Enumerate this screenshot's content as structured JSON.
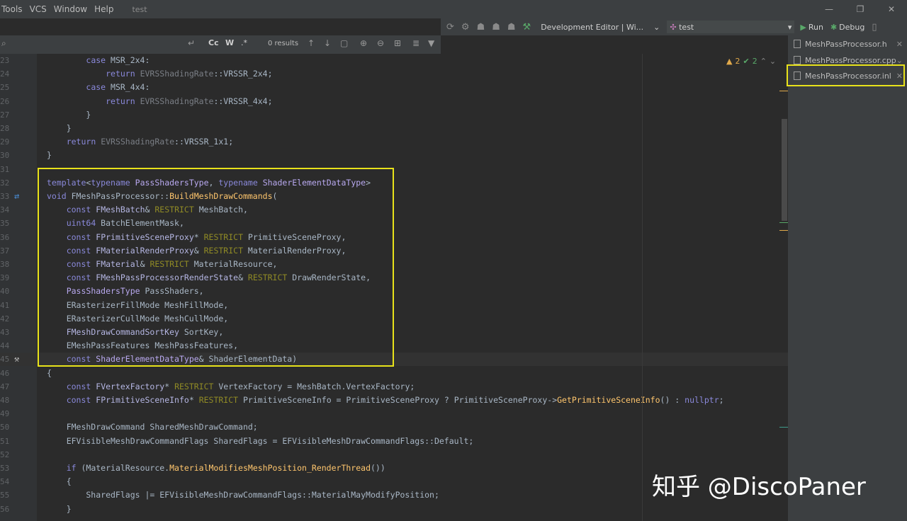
{
  "menu": [
    "Tools",
    "VCS",
    "Window",
    "Help"
  ],
  "window_title": "test",
  "run_toolbar": {
    "configuration": "Development Editor | Wi...",
    "target": "test",
    "run_label": "Run",
    "debug_label": "Debug"
  },
  "search": {
    "case_label": "Cc",
    "word_label": "W",
    "regex_label": ".*",
    "results": "0 results"
  },
  "editor_tabs": [
    "MeshPassProcessor.h",
    "MeshPassProcessor.cpp",
    "MeshPassProcessor.inl"
  ],
  "inspection": {
    "warnings": "2",
    "ok": "2"
  },
  "lines": [
    {
      "n": "23",
      "t": "        case MSR_2x4:"
    },
    {
      "n": "24",
      "t": "            return EVRSShadingRate::VRSSR_2x4;"
    },
    {
      "n": "25",
      "t": "        case MSR_4x4:"
    },
    {
      "n": "26",
      "t": "            return EVRSShadingRate::VRSSR_4x4;"
    },
    {
      "n": "27",
      "t": "        }"
    },
    {
      "n": "28",
      "t": "    }"
    },
    {
      "n": "29",
      "t": "    return EVRSShadingRate::VRSSR_1x1;"
    },
    {
      "n": "30",
      "t": "}"
    },
    {
      "n": "31",
      "t": ""
    },
    {
      "n": "32",
      "t": "template<typename PassShadersType, typename ShaderElementDataType>"
    },
    {
      "n": "33",
      "t": "void FMeshPassProcessor::BuildMeshDrawCommands("
    },
    {
      "n": "34",
      "t": "    const FMeshBatch& RESTRICT MeshBatch,"
    },
    {
      "n": "35",
      "t": "    uint64 BatchElementMask,"
    },
    {
      "n": "36",
      "t": "    const FPrimitiveSceneProxy* RESTRICT PrimitiveSceneProxy,"
    },
    {
      "n": "37",
      "t": "    const FMaterialRenderProxy& RESTRICT MaterialRenderProxy,"
    },
    {
      "n": "38",
      "t": "    const FMaterial& RESTRICT MaterialResource,"
    },
    {
      "n": "39",
      "t": "    const FMeshPassProcessorRenderState& RESTRICT DrawRenderState,"
    },
    {
      "n": "40",
      "t": "    PassShadersType PassShaders,"
    },
    {
      "n": "41",
      "t": "    ERasterizerFillMode MeshFillMode,"
    },
    {
      "n": "42",
      "t": "    ERasterizerCullMode MeshCullMode,"
    },
    {
      "n": "43",
      "t": "    FMeshDrawCommandSortKey SortKey,"
    },
    {
      "n": "44",
      "t": "    EMeshPassFeatures MeshPassFeatures,"
    },
    {
      "n": "45",
      "t": "    const ShaderElementDataType& ShaderElementData)"
    },
    {
      "n": "46",
      "t": "{"
    },
    {
      "n": "47",
      "t": "    const FVertexFactory* RESTRICT VertexFactory = MeshBatch.VertexFactory;"
    },
    {
      "n": "48",
      "t": "    const FPrimitiveSceneInfo* RESTRICT PrimitiveSceneInfo = PrimitiveSceneProxy ? PrimitiveSceneProxy->GetPrimitiveSceneInfo() : nullptr;"
    },
    {
      "n": "49",
      "t": ""
    },
    {
      "n": "50",
      "t": "    FMeshDrawCommand SharedMeshDrawCommand;"
    },
    {
      "n": "51",
      "t": "    EFVisibleMeshDrawCommandFlags SharedFlags = EFVisibleMeshDrawCommandFlags::Default;"
    },
    {
      "n": "52",
      "t": ""
    },
    {
      "n": "53",
      "t": "    if (MaterialResource.MaterialModifiesMeshPosition_RenderThread())"
    },
    {
      "n": "54",
      "t": "    {"
    },
    {
      "n": "55",
      "t": "        SharedFlags |= EFVisibleMeshDrawCommandFlags::MaterialMayModifyPosition;"
    },
    {
      "n": "56",
      "t": "    }"
    }
  ],
  "watermark": "知乎 @DiscoPaner"
}
